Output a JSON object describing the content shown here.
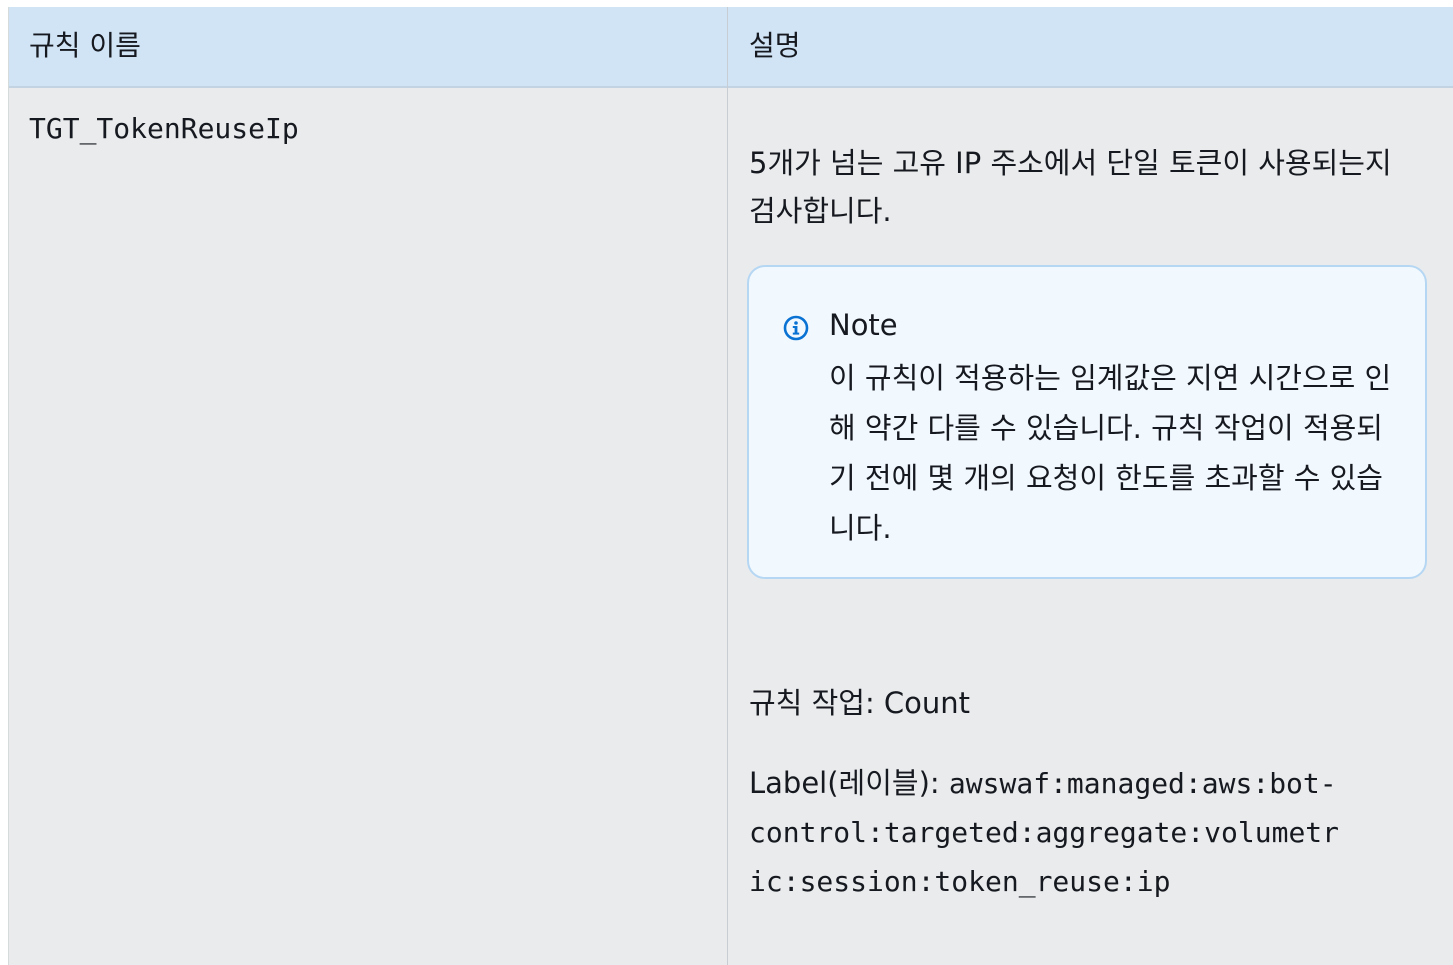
{
  "table": {
    "headers": {
      "name": "규칙 이름",
      "description": "설명"
    },
    "rows": [
      {
        "name": "TGT_TokenReuseIp",
        "description": "5개가 넘는 고유 IP 주소에서 단일 토큰이 사용되는지 검사합니다.",
        "note": {
          "icon": "info-icon",
          "title": "Note",
          "body": "이 규칙이 적용하는 임계값은 지연 시간으로 인해 약간 다를 수 있습니다. 규칙 작업이 적용되기 전에 몇 개의 요청이 한도를 초과할 수 있습니다."
        },
        "action_text": "규칙 작업: Count",
        "label_prefix": "Label(레이블): ",
        "label_value": "awswaf:managed:aws:bot-control:targeted:aggregate:volumetric:session:token_reuse:ip"
      }
    ]
  },
  "colors": {
    "header_bg": "#d1e4f6",
    "body_bg": "#e9ebed",
    "note_bg": "#f1f8fe",
    "note_border": "#b6d7f3",
    "info_icon": "#0972d3"
  }
}
